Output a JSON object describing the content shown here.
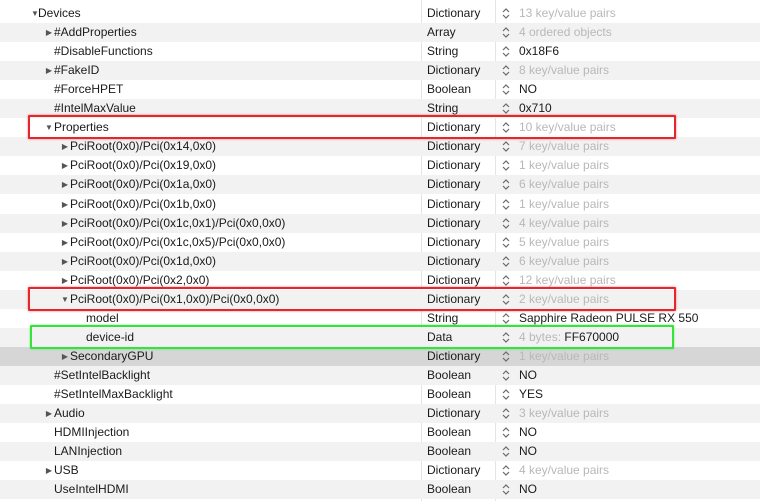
{
  "rows": [
    {
      "key": "Devices",
      "type": "Dictionary",
      "value": "13 key/value pairs",
      "level": 0,
      "disclosure": "open",
      "dim": true
    },
    {
      "key": "#AddProperties",
      "type": "Array",
      "value": "4 ordered objects",
      "level": 1,
      "disclosure": "closed",
      "dim": true
    },
    {
      "key": "#DisableFunctions",
      "type": "String",
      "value": "0x18F6",
      "level": 1,
      "disclosure": "none",
      "dim": false
    },
    {
      "key": "#FakeID",
      "type": "Dictionary",
      "value": "8 key/value pairs",
      "level": 1,
      "disclosure": "closed",
      "dim": true
    },
    {
      "key": "#ForceHPET",
      "type": "Boolean",
      "value": "NO",
      "level": 1,
      "disclosure": "none",
      "dim": false
    },
    {
      "key": "#IntelMaxValue",
      "type": "String",
      "value": "0x710",
      "level": 1,
      "disclosure": "none",
      "dim": false
    },
    {
      "key": "Properties",
      "type": "Dictionary",
      "value": "10 key/value pairs",
      "level": 1,
      "disclosure": "open",
      "dim": true
    },
    {
      "key": "PciRoot(0x0)/Pci(0x14,0x0)",
      "type": "Dictionary",
      "value": "7 key/value pairs",
      "level": 2,
      "disclosure": "closed",
      "dim": true
    },
    {
      "key": "PciRoot(0x0)/Pci(0x19,0x0)",
      "type": "Dictionary",
      "value": "1 key/value pairs",
      "level": 2,
      "disclosure": "closed",
      "dim": true
    },
    {
      "key": "PciRoot(0x0)/Pci(0x1a,0x0)",
      "type": "Dictionary",
      "value": "6 key/value pairs",
      "level": 2,
      "disclosure": "closed",
      "dim": true
    },
    {
      "key": "PciRoot(0x0)/Pci(0x1b,0x0)",
      "type": "Dictionary",
      "value": "1 key/value pairs",
      "level": 2,
      "disclosure": "closed",
      "dim": true
    },
    {
      "key": "PciRoot(0x0)/Pci(0x1c,0x1)/Pci(0x0,0x0)",
      "type": "Dictionary",
      "value": "4 key/value pairs",
      "level": 2,
      "disclosure": "closed",
      "dim": true
    },
    {
      "key": "PciRoot(0x0)/Pci(0x1c,0x5)/Pci(0x0,0x0)",
      "type": "Dictionary",
      "value": "5 key/value pairs",
      "level": 2,
      "disclosure": "closed",
      "dim": true
    },
    {
      "key": "PciRoot(0x0)/Pci(0x1d,0x0)",
      "type": "Dictionary",
      "value": "6 key/value pairs",
      "level": 2,
      "disclosure": "closed",
      "dim": true
    },
    {
      "key": "PciRoot(0x0)/Pci(0x2,0x0)",
      "type": "Dictionary",
      "value": "12 key/value pairs",
      "level": 2,
      "disclosure": "closed",
      "dim": true
    },
    {
      "key": "PciRoot(0x0)/Pci(0x1,0x0)/Pci(0x0,0x0)",
      "type": "Dictionary",
      "value": "2 key/value pairs",
      "level": 2,
      "disclosure": "open",
      "dim": true
    },
    {
      "key": "model",
      "type": "String",
      "value": "Sapphire Radeon PULSE RX 550",
      "level": 3,
      "disclosure": "none",
      "dim": false
    },
    {
      "key": "device-id",
      "type": "Data",
      "value_dim": "4 bytes:",
      "value": "FF670000",
      "level": 3,
      "disclosure": "none",
      "dim": false,
      "mixed": true
    },
    {
      "key": "SecondaryGPU",
      "type": "Dictionary",
      "value": "1 key/value pairs",
      "level": 2,
      "disclosure": "closed",
      "dim": true,
      "selected": true
    },
    {
      "key": "#SetIntelBacklight",
      "type": "Boolean",
      "value": "NO",
      "level": 1,
      "disclosure": "none",
      "dim": false
    },
    {
      "key": "#SetIntelMaxBacklight",
      "type": "Boolean",
      "value": "YES",
      "level": 1,
      "disclosure": "none",
      "dim": false
    },
    {
      "key": "Audio",
      "type": "Dictionary",
      "value": "3 key/value pairs",
      "level": 1,
      "disclosure": "closed",
      "dim": true
    },
    {
      "key": "HDMIInjection",
      "type": "Boolean",
      "value": "NO",
      "level": 1,
      "disclosure": "none",
      "dim": false
    },
    {
      "key": "LANInjection",
      "type": "Boolean",
      "value": "NO",
      "level": 1,
      "disclosure": "none",
      "dim": false
    },
    {
      "key": "USB",
      "type": "Dictionary",
      "value": "4 key/value pairs",
      "level": 1,
      "disclosure": "closed",
      "dim": true
    },
    {
      "key": "UseIntelHDMI",
      "type": "Boolean",
      "value": "NO",
      "level": 1,
      "disclosure": "none",
      "dim": false
    }
  ],
  "highlights": [
    {
      "row_index": 6,
      "color": "#e5262a",
      "kind": "red"
    },
    {
      "row_index": 15,
      "color": "#e5262a",
      "kind": "red"
    },
    {
      "row_index": 17,
      "color": "#37e23a",
      "kind": "green"
    }
  ],
  "icons": {
    "open": "triangle-down-icon",
    "closed": "triangle-right-icon",
    "stepper": "up-down-stepper-icon"
  }
}
